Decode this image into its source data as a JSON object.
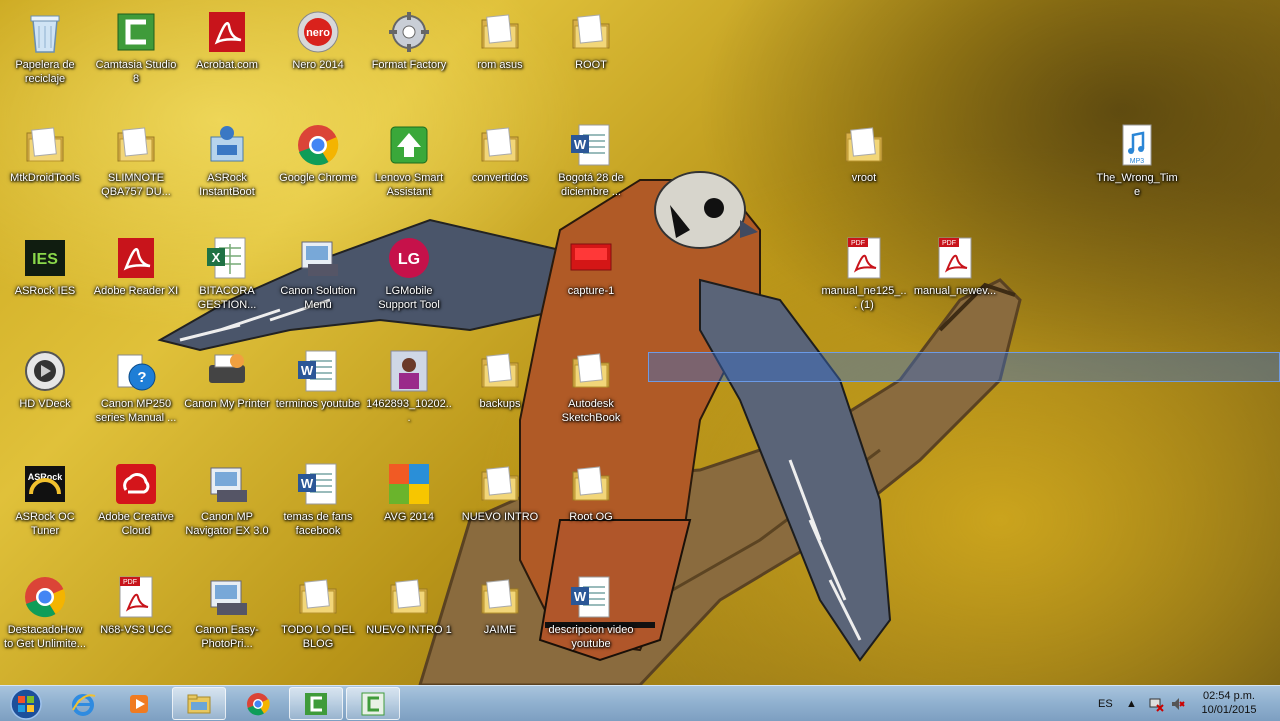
{
  "desktop": {
    "icons": [
      {
        "label": "Papelera de reciclaje",
        "icon": "recycle-bin-icon"
      },
      {
        "label": "Camtasia Studio 8",
        "icon": "camtasia-icon"
      },
      {
        "label": "Acrobat.com",
        "icon": "pdf-icon"
      },
      {
        "label": "Nero 2014",
        "icon": "nero-icon"
      },
      {
        "label": "Format Factory",
        "icon": "format-factory-icon"
      },
      {
        "label": "rom asus",
        "icon": "folder-icon"
      },
      {
        "label": "ROOT",
        "icon": "folder-icon"
      },
      {
        "label": "MtkDroidTools",
        "icon": "folder-icon"
      },
      {
        "label": "SLIMNOTE QBA757 DU...",
        "icon": "folder-icon"
      },
      {
        "label": "ASRock InstantBoot",
        "icon": "asrock-icon"
      },
      {
        "label": "Google Chrome",
        "icon": "chrome-icon"
      },
      {
        "label": "Lenovo Smart Assistant",
        "icon": "lenovo-icon"
      },
      {
        "label": "convertidos",
        "icon": "folder-icon"
      },
      {
        "label": "Bogotá 28 de diciembre ...",
        "icon": "word-icon"
      },
      {
        "label": "vroot",
        "icon": "folder-icon"
      },
      {
        "label": "The_Wrong_Time",
        "icon": "mp3-icon"
      },
      {
        "label": "ASRock IES",
        "icon": "ies-icon"
      },
      {
        "label": "Adobe Reader XI",
        "icon": "pdf-icon"
      },
      {
        "label": "BITACORA GESTION...",
        "icon": "excel-icon"
      },
      {
        "label": "Canon Solution Menu",
        "icon": "canon-icon"
      },
      {
        "label": "LGMobile Support Tool",
        "icon": "lg-icon"
      },
      {
        "label": "capture-1",
        "icon": "capture-icon"
      },
      {
        "label": "manual_ne125_... (1)",
        "icon": "pdf-file-icon"
      },
      {
        "label": "manual_newev...",
        "icon": "pdf-file-icon"
      },
      {
        "label": "HD VDeck",
        "icon": "hdvdeck-icon"
      },
      {
        "label": "Canon MP250 series Manual ...",
        "icon": "help-icon"
      },
      {
        "label": "Canon My Printer",
        "icon": "printer-icon"
      },
      {
        "label": "terminos youtube",
        "icon": "word-icon"
      },
      {
        "label": "1462893_10202...",
        "icon": "photo-icon"
      },
      {
        "label": "backups",
        "icon": "folder-icon"
      },
      {
        "label": "Autodesk SketchBook",
        "icon": "folder-icon"
      },
      {
        "label": "ASRock OC Tuner",
        "icon": "asrock-oc-icon"
      },
      {
        "label": "Adobe Creative Cloud",
        "icon": "creative-cloud-icon"
      },
      {
        "label": "Canon MP Navigator EX 3.0",
        "icon": "canon-icon"
      },
      {
        "label": "temas de fans facebook",
        "icon": "word-icon"
      },
      {
        "label": "AVG 2014",
        "icon": "avg-icon"
      },
      {
        "label": "NUEVO INTRO",
        "icon": "folder-icon"
      },
      {
        "label": "Root OG",
        "icon": "folder-icon"
      },
      {
        "label": "DestacadoHow to Get Unlimite...",
        "icon": "chrome-icon"
      },
      {
        "label": "N68-VS3 UCC",
        "icon": "pdf-file-icon"
      },
      {
        "label": "Canon Easy-PhotoPri...",
        "icon": "canon-icon"
      },
      {
        "label": "TODO LO DEL BLOG",
        "icon": "folder-icon"
      },
      {
        "label": "NUEVO INTRO 1",
        "icon": "folder-icon"
      },
      {
        "label": "JAIME",
        "icon": "folder-icon"
      },
      {
        "label": "descripcion video youtube",
        "icon": "word-icon"
      }
    ]
  },
  "taskbar": {
    "start_icon": "windows-start-icon",
    "pinned": [
      "internet-explorer-icon",
      "media-player-icon",
      "file-explorer-icon",
      "chrome-icon",
      "camtasia-icon",
      "camtasia-recorder-icon"
    ],
    "language": "ES",
    "time": "02:54 p.m.",
    "date": "10/01/2015"
  },
  "colors": {
    "taskbar": "#8fb0cf",
    "folder": "#e8c860",
    "word_blue": "#2b5797",
    "pdf_red": "#c8141b",
    "selection": "#3c6ec8"
  }
}
